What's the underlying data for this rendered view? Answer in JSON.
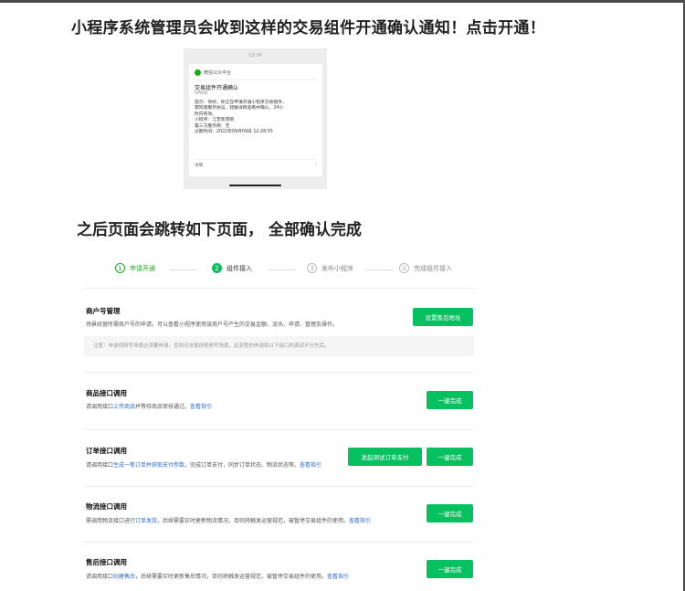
{
  "heading_top": "小程序系统管理员会收到这样的交易组件开通确认通知！点击开通！",
  "heading_mid": "之后页面会跳转如下页面， 全部确认完成",
  "phone": {
    "time": "12:34",
    "brand": "微信公众平台",
    "title": "交易组件开通确认",
    "date": "9月8日",
    "body": [
      "提示：你好，你正在申请开通小程序交易组件，",
      "需同意服务协议，轻触详情查看并确认，24小",
      "时内有效。",
      "小程序：江普客营销",
      "第三方服务商：无",
      "过期时间：2022年09月09日 12:28:55"
    ],
    "detail": "详情",
    "arrow": "›"
  },
  "steps": [
    {
      "num": "1",
      "label": "申请开通"
    },
    {
      "num": "2",
      "label": "组件接入"
    },
    {
      "num": "3",
      "label": "发布小程序"
    },
    {
      "num": "4",
      "label": "完成组件接入"
    }
  ],
  "merchant": {
    "title": "商户号管理",
    "desc": "场景经营所需商户号的申请，可以查看小程序使用该商户号产生的交易金额、流水、申请、管理及操作。",
    "note": "注意：申请视频号场景必须要申请，否则无法使用视频号场景，此流程的申请和以下接口的调试不分先后。",
    "button": "设置售后地址"
  },
  "goods": {
    "title": "商品接口调用",
    "desc_pre": "请调用接口",
    "desc_link": "上传商品",
    "desc_post": "并等待商品审核通过。",
    "guide": "查看指引",
    "button": "一键完成"
  },
  "order": {
    "title": "订单接口调用",
    "desc_pre": "请调用接口",
    "desc_link": "生成一笔订单并获取支付参数",
    "desc_post": "，完成订单支付，同步订单状态、物流状态等。",
    "guide": "查看指引",
    "button_test": "发起测试订单支付",
    "button": "一键完成"
  },
  "logistics": {
    "title": "物流接口调用",
    "desc_pre": "需调用物流接口进行",
    "desc_link": "订单发货",
    "desc_post": "。后续需要实时更新物流情况，否则将触发运营规范，被暂停交易组件的使用。",
    "guide": "查看指引",
    "button": "一键完成"
  },
  "aftersale": {
    "title": "售后接口调用",
    "desc_pre": "请调用接口",
    "desc_link": "创建售后",
    "desc_post": "，后续需要实时更新售后情况，否则将触发运营规范，被暂停交易组件的使用。",
    "guide": "查看指引",
    "button": "一键完成"
  }
}
